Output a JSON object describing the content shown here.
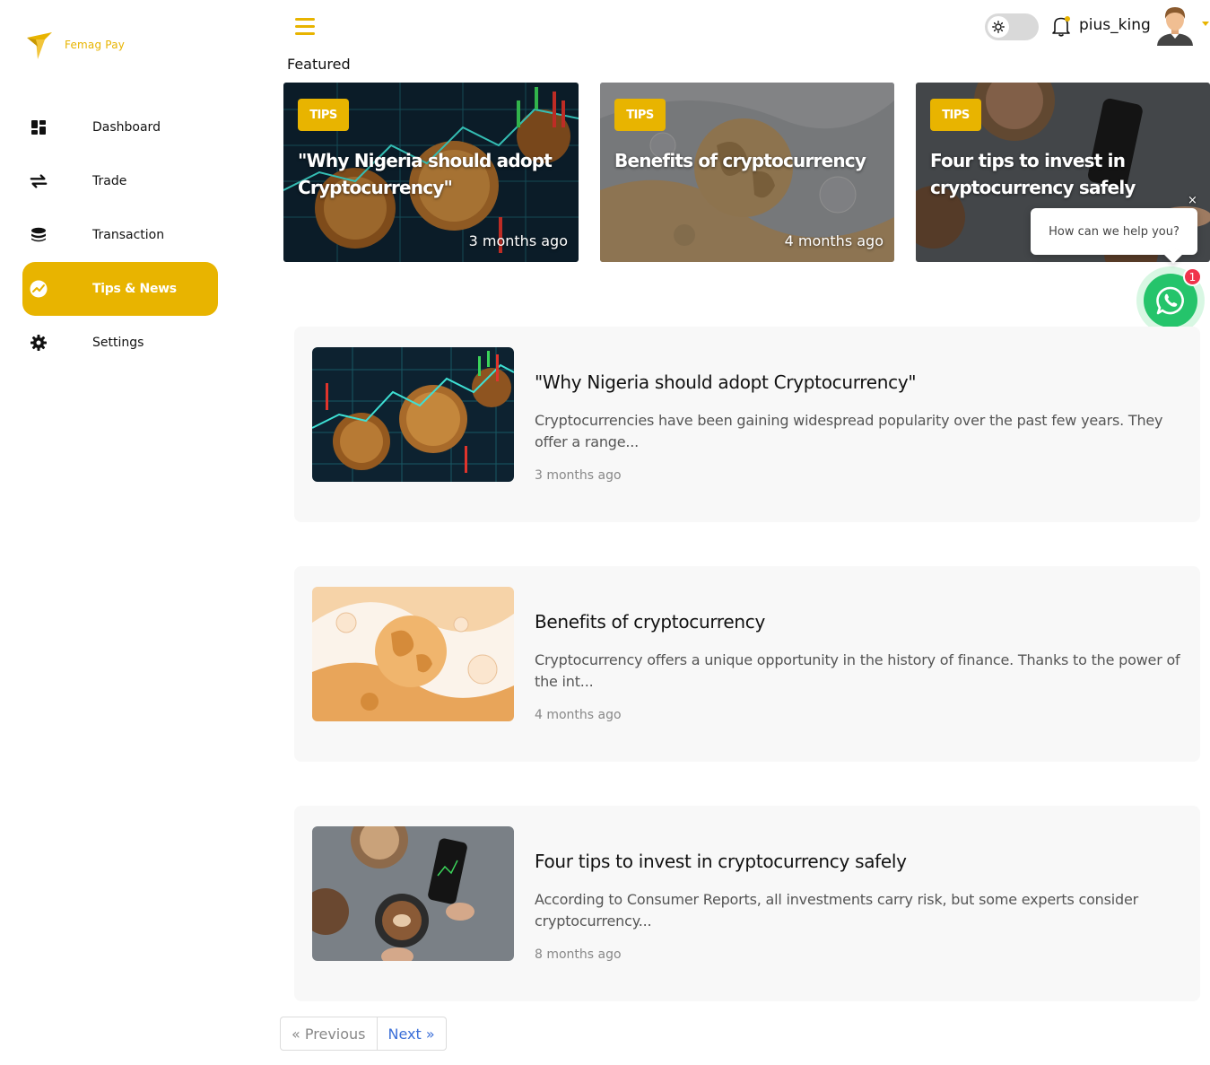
{
  "brand": {
    "name": "Femag Pay",
    "color": "#e8b400"
  },
  "sidebar": {
    "items": [
      {
        "label": "Dashboard",
        "icon": "dashboard-grid-icon",
        "active": false
      },
      {
        "label": "Trade",
        "icon": "swap-arrows-icon",
        "active": false
      },
      {
        "label": "Transaction",
        "icon": "coin-stack-icon",
        "active": false
      },
      {
        "label": "Tips & News",
        "icon": "trend-chart-icon",
        "active": true
      },
      {
        "label": "Settings",
        "icon": "gear-icon",
        "active": false
      }
    ]
  },
  "header": {
    "menu_icon": "hamburger-icon",
    "theme_icon": "sun-icon",
    "notification_icon": "bell-icon",
    "username": "pius_king"
  },
  "featured": {
    "title": "Featured",
    "cards": [
      {
        "tag": "TIPS",
        "title": "\"Why Nigeria should adopt Cryptocurrency\"",
        "date": "3 months ago"
      },
      {
        "tag": "TIPS",
        "title": "Benefits of cryptocurrency",
        "date": "4 months ago"
      },
      {
        "tag": "TIPS",
        "title": "Four tips to invest in cryptocurrency safely",
        "date": ""
      }
    ]
  },
  "articles": [
    {
      "title": "\"Why Nigeria should adopt Cryptocurrency\"",
      "excerpt": "Cryptocurrencies have been gaining widespread popularity over the past few years. They offer a range...",
      "date": "3 months ago"
    },
    {
      "title": "Benefits of cryptocurrency",
      "excerpt": "Cryptocurrency offers a unique opportunity in the history of finance. Thanks to the power of the int...",
      "date": "4 months ago"
    },
    {
      "title": "Four tips to invest in cryptocurrency safely",
      "excerpt": "According to Consumer Reports, all investments carry risk, but some experts consider cryptocurrency...",
      "date": "8 months ago"
    }
  ],
  "pagination": {
    "previous": "« Previous",
    "next": "Next »"
  },
  "chat": {
    "prompt": "How can we help you?",
    "close": "×",
    "badge_count": "1",
    "icon": "whatsapp-icon"
  }
}
